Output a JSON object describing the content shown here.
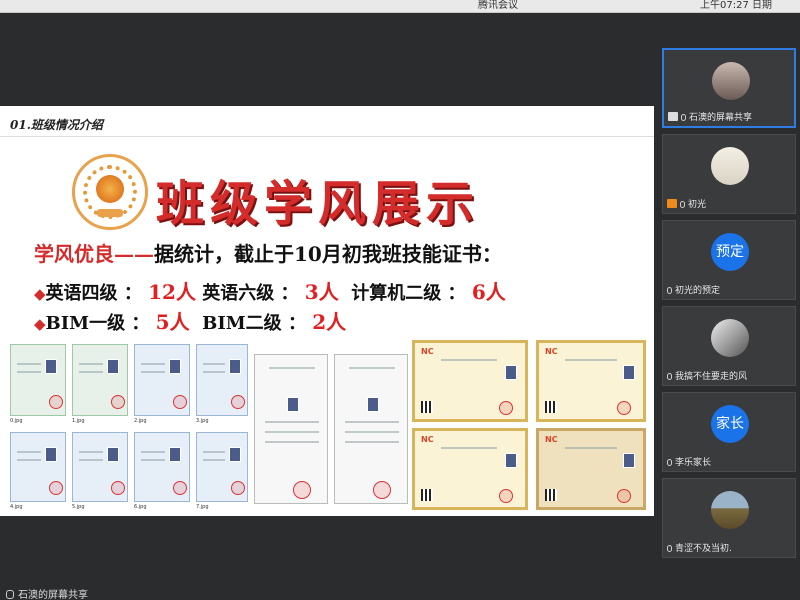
{
  "app": {
    "window_title": "腾讯会议",
    "clock": "上午07:27 日期"
  },
  "slide": {
    "section_title": "01.班级情况介绍",
    "big_title": "班级学风展示",
    "intro_red": "学风优良——",
    "intro_black": "据统计，截止于10月初我班技能证书：",
    "row1": {
      "a_label": "英语四级 ：",
      "a_value": "12人",
      "b_label": "英语六级 ：",
      "b_value": "3人",
      "c_label": "计算机二级 ：",
      "c_value": "6人"
    },
    "row2": {
      "a_label": "BIM一级 ：",
      "a_value": "5人",
      "b_label": "BIM二级 ：",
      "b_value": "2人"
    },
    "diamond": "◆",
    "cert_files": [
      "0.jpg",
      "1.jpg",
      "2.jpg",
      "3.jpg",
      "4.jpg",
      "5.jpg",
      "6.jpg",
      "7.jpg"
    ]
  },
  "participants": [
    {
      "name": "石澳的屏幕共享",
      "avatar": "photo-avatar-icon",
      "active": true
    },
    {
      "name": "初光",
      "avatar": "photo-avatar-icon",
      "active": false
    },
    {
      "name": "初光的预定",
      "avatar_text": "预定",
      "active": false
    },
    {
      "name": "我搞不住要走的风",
      "avatar": "photo-avatar-icon",
      "active": false
    },
    {
      "name": "李乐家长",
      "avatar_text": "家长",
      "active": false
    },
    {
      "name": "青涩不及当初.",
      "avatar": "photo-avatar-icon",
      "active": false
    }
  ],
  "bottom": {
    "share_label": "石澳的屏幕共享"
  },
  "colors": {
    "accent_red": "#d42b2b",
    "tile_blue": "#1a73e8",
    "active_border": "#2f7de1"
  }
}
